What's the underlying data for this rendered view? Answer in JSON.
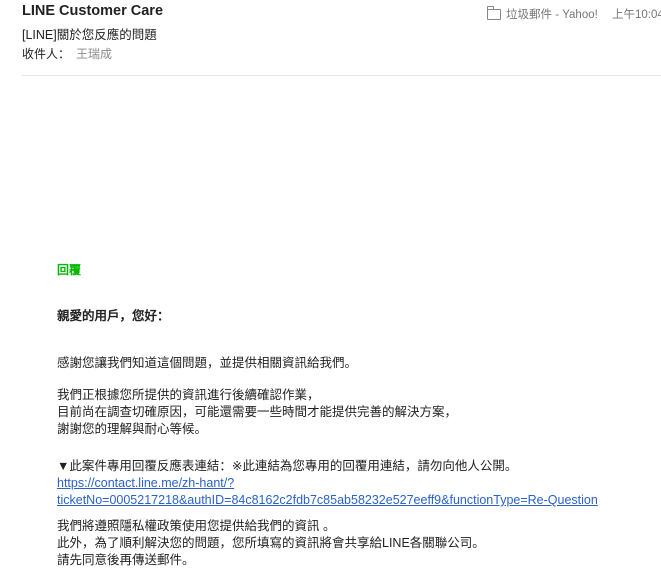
{
  "header": {
    "sender": "LINE Customer Care",
    "subject": "[LINE]關於您反應的問題",
    "to_label": "收件人：",
    "to_name": "王瑞成",
    "folder": "垃圾郵件 - Yahoo!",
    "time": "上午10:04"
  },
  "body": {
    "reply_label": "回覆",
    "greeting": "親愛的用戶，您好：",
    "paragraph1": "感謝您讓我們知道這個問題，並提供相關資訊給我們。",
    "paragraph2": [
      "我們正根據您所提供的資訊進行後續確認作業，",
      "目前尚在調查切確原因，可能還需要一些時間才能提供完善的解決方案，",
      "謝謝您的理解與耐心等候。"
    ],
    "form_notice": "▼此案件專用回覆反應表連結：※此連結為您專用的回覆用連結，請勿向他人公開。",
    "link_line1": "https://contact.line.me/zh-hant/?",
    "link_line2": "ticketNo=0005217218&authID=84c8162c2fdb7c85ab58232e527eeff9&functionType=Re-Question",
    "paragraph4": [
      "我們將遵照隱私權政策使用您提供給我們的資訊 。",
      "此外，為了順利解決您的問題，您所填寫的資訊將會共享給LINE各關聯公司。",
      "請先同意後再傳送郵件。"
    ]
  },
  "colors": {
    "reply_label": "#00b900",
    "link": "#2a61c9",
    "muted": "#8a8a8a"
  }
}
